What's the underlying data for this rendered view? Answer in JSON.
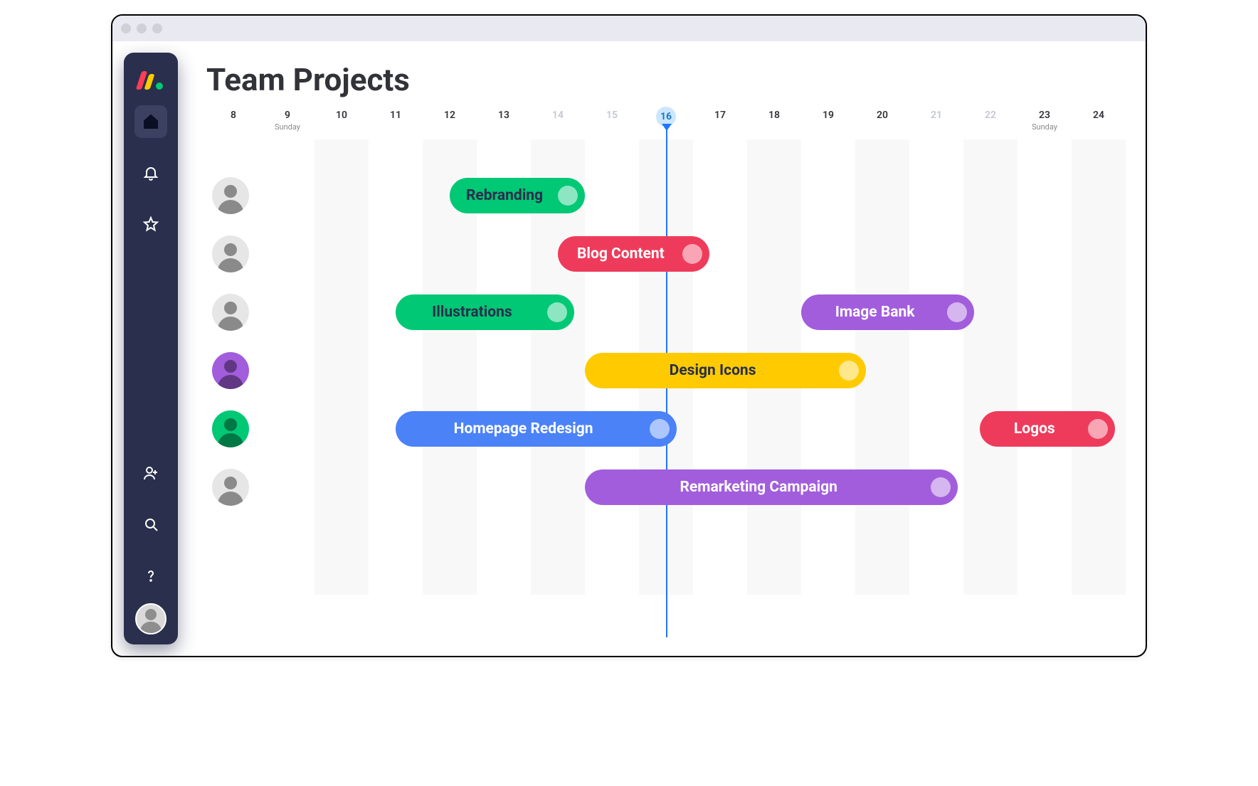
{
  "header": {
    "title": "Team Projects"
  },
  "timeline": {
    "today_index": 8,
    "days": [
      {
        "num": "8",
        "sub": "",
        "muted": false
      },
      {
        "num": "9",
        "sub": "Sunday",
        "muted": false
      },
      {
        "num": "10",
        "sub": "",
        "muted": false
      },
      {
        "num": "11",
        "sub": "",
        "muted": false
      },
      {
        "num": "12",
        "sub": "",
        "muted": false
      },
      {
        "num": "13",
        "sub": "",
        "muted": false
      },
      {
        "num": "14",
        "sub": "",
        "muted": true
      },
      {
        "num": "15",
        "sub": "",
        "muted": true
      },
      {
        "num": "16",
        "sub": "",
        "muted": false,
        "today": true
      },
      {
        "num": "17",
        "sub": "",
        "muted": false
      },
      {
        "num": "18",
        "sub": "",
        "muted": false
      },
      {
        "num": "19",
        "sub": "",
        "muted": false
      },
      {
        "num": "20",
        "sub": "",
        "muted": false
      },
      {
        "num": "21",
        "sub": "",
        "muted": true
      },
      {
        "num": "22",
        "sub": "",
        "muted": true
      },
      {
        "num": "23",
        "sub": "Sunday",
        "muted": false
      },
      {
        "num": "24",
        "sub": "",
        "muted": false
      }
    ]
  },
  "chart_data": {
    "type": "gantt",
    "x_range": [
      8,
      24
    ],
    "today": 16,
    "rows": [
      {
        "avatar_bg": "#e6e6e6",
        "tasks": [
          {
            "label": "Rebranding",
            "start": 12,
            "end": 14.5,
            "color": "green"
          }
        ]
      },
      {
        "avatar_bg": "#e6e6e6",
        "tasks": [
          {
            "label": "Blog Content",
            "start": 14,
            "end": 16.8,
            "color": "red"
          }
        ]
      },
      {
        "avatar_bg": "#e6e6e6",
        "tasks": [
          {
            "label": "Illustrations",
            "start": 11,
            "end": 14.3,
            "color": "green"
          },
          {
            "label": "Image Bank",
            "start": 18.5,
            "end": 21.7,
            "color": "purple"
          }
        ]
      },
      {
        "avatar_bg": "#a25ddc",
        "tasks": [
          {
            "label": "Design Icons",
            "start": 14.5,
            "end": 19.7,
            "color": "yellow"
          }
        ]
      },
      {
        "avatar_bg": "#00c875",
        "tasks": [
          {
            "label": "Homepage Redesign",
            "start": 11,
            "end": 16.2,
            "color": "blue"
          },
          {
            "label": "Logos",
            "start": 21.8,
            "end": 24.3,
            "color": "red"
          }
        ]
      },
      {
        "avatar_bg": "#e6e6e6",
        "tasks": [
          {
            "label": "Remarketing Campaign",
            "start": 14.5,
            "end": 21.4,
            "color": "purple"
          }
        ]
      }
    ]
  },
  "sidebar": {
    "items_top": [
      {
        "name": "home-icon",
        "active": true
      },
      {
        "name": "bell-icon",
        "active": false
      },
      {
        "name": "star-icon",
        "active": false
      }
    ],
    "items_bottom": [
      {
        "name": "add-user-icon"
      },
      {
        "name": "search-icon"
      },
      {
        "name": "help-icon"
      }
    ]
  }
}
